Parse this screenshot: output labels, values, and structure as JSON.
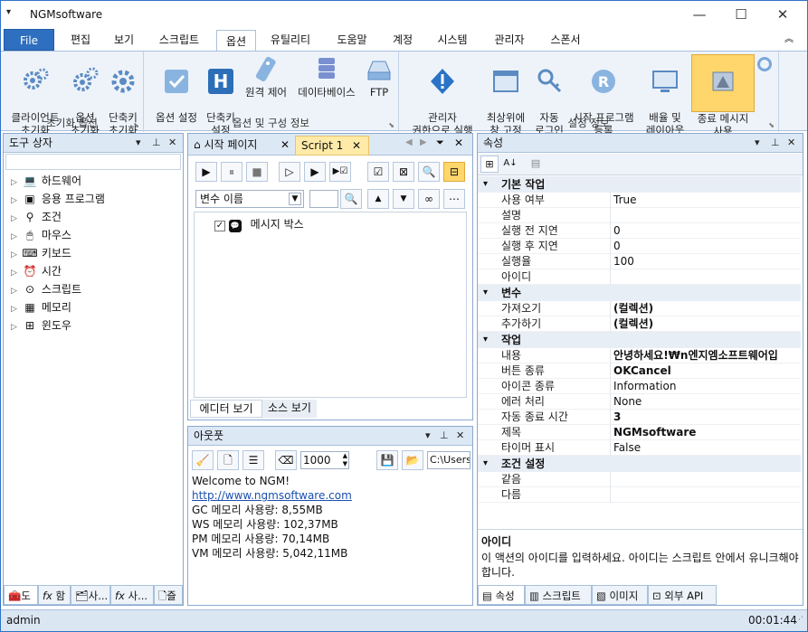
{
  "app": {
    "title": "NGMsoftware",
    "user": "admin",
    "clock": "00:01:44"
  },
  "menu": {
    "file": "File",
    "tabs": [
      "편집",
      "보기",
      "스크립트",
      "옵션",
      "유틸리티",
      "도움말",
      "계정",
      "시스템",
      "관리자",
      "스폰서"
    ]
  },
  "ribbon": {
    "group1": {
      "caption": "초기화 옵션",
      "buttons": [
        "클라이언트\n초기화",
        "옵션\n초기화",
        "단축키\n초기화"
      ]
    },
    "group2": {
      "caption": "옵션 및 구성 정보",
      "buttons": [
        "옵션 설정",
        "단축키\n설정",
        "원격 제어",
        "데이타베이스",
        "FTP"
      ]
    },
    "group3": {
      "caption": "설정 정보",
      "buttons": [
        "관리자\n권한으로 실행",
        "최상위에\n창 고정",
        "자동\n로그인",
        "시작 프로그램\n등록",
        "배율 및\n레이아웃",
        "종료 메시지\n사용"
      ]
    }
  },
  "toolbox": {
    "title": "도구 상자",
    "items": [
      {
        "icon": "💻",
        "label": "하드웨어"
      },
      {
        "icon": "▣",
        "label": "응용 프로그램"
      },
      {
        "icon": "⚲",
        "label": "조건"
      },
      {
        "icon": "🖱",
        "label": "마우스"
      },
      {
        "icon": "⌨",
        "label": "키보드"
      },
      {
        "icon": "⏰",
        "label": "시간"
      },
      {
        "icon": "⊙",
        "label": "스크립트"
      },
      {
        "icon": "▦",
        "label": "메모리"
      },
      {
        "icon": "⊞",
        "label": "윈도우"
      }
    ],
    "bottom_tabs": [
      "도",
      "함",
      "사...",
      "사...",
      "즐"
    ]
  },
  "editor": {
    "tabs": [
      "시작 페이지",
      "Script 1"
    ],
    "variable_select": "변수 이름",
    "node_label": "메시지 박스",
    "view_tabs": [
      "에디터 보기",
      "소스 보기"
    ]
  },
  "output": {
    "title": "아웃풋",
    "number": "1000",
    "path": "C:\\Users",
    "lines": [
      "Welcome to NGM!",
      "http://www.ngmsoftware.com",
      "GC 메모리 사용량: 8,55MB",
      "WS 메모리 사용량: 102,37MB",
      "PM 메모리 사용량: 70,14MB",
      "VM 메모리 사용량: 5,042,11MB"
    ]
  },
  "properties": {
    "title": "속성",
    "categories": [
      {
        "name": "기본 작업",
        "rows": [
          {
            "n": "사용 여부",
            "v": "True",
            "b": false
          },
          {
            "n": "설명",
            "v": "",
            "b": false
          },
          {
            "n": "실행 전 지연",
            "v": "0",
            "b": false
          },
          {
            "n": "실행 후 지연",
            "v": "0",
            "b": false
          },
          {
            "n": "실행율",
            "v": "100",
            "b": false
          },
          {
            "n": "아이디",
            "v": "",
            "b": false
          }
        ]
      },
      {
        "name": "변수",
        "rows": [
          {
            "n": "가져오기",
            "v": "(컬렉션)",
            "b": true
          },
          {
            "n": "추가하기",
            "v": "(컬렉션)",
            "b": true
          }
        ]
      },
      {
        "name": "작업",
        "rows": [
          {
            "n": "내용",
            "v": "안녕하세요!₩n엔지엠소프트웨어입",
            "b": true
          },
          {
            "n": "버튼 종류",
            "v": "OKCancel",
            "b": true
          },
          {
            "n": "아이콘 종류",
            "v": "Information",
            "b": false
          },
          {
            "n": "에러 처리",
            "v": "None",
            "b": false
          },
          {
            "n": "자동 종료 시간",
            "v": "3",
            "b": true
          },
          {
            "n": "제목",
            "v": "NGMsoftware",
            "b": true
          },
          {
            "n": "타이머 표시",
            "v": "False",
            "b": false
          }
        ]
      },
      {
        "name": "조건 설정",
        "rows": [
          {
            "n": "같음",
            "v": "",
            "b": false
          },
          {
            "n": "다름",
            "v": "",
            "b": false
          }
        ]
      }
    ],
    "help_title": "아이디",
    "help_text": "이 액션의 아이디를 입력하세요. 아이디는 스크립트 안에서 유니크해야 합니다.",
    "bottom_tabs": [
      "속성",
      "스크립트",
      "이미지",
      "외부 API"
    ]
  },
  "colors": {
    "accent": "#2e6fbf",
    "highlight": "#ffd66b",
    "panel_head": "#dde8f5"
  }
}
